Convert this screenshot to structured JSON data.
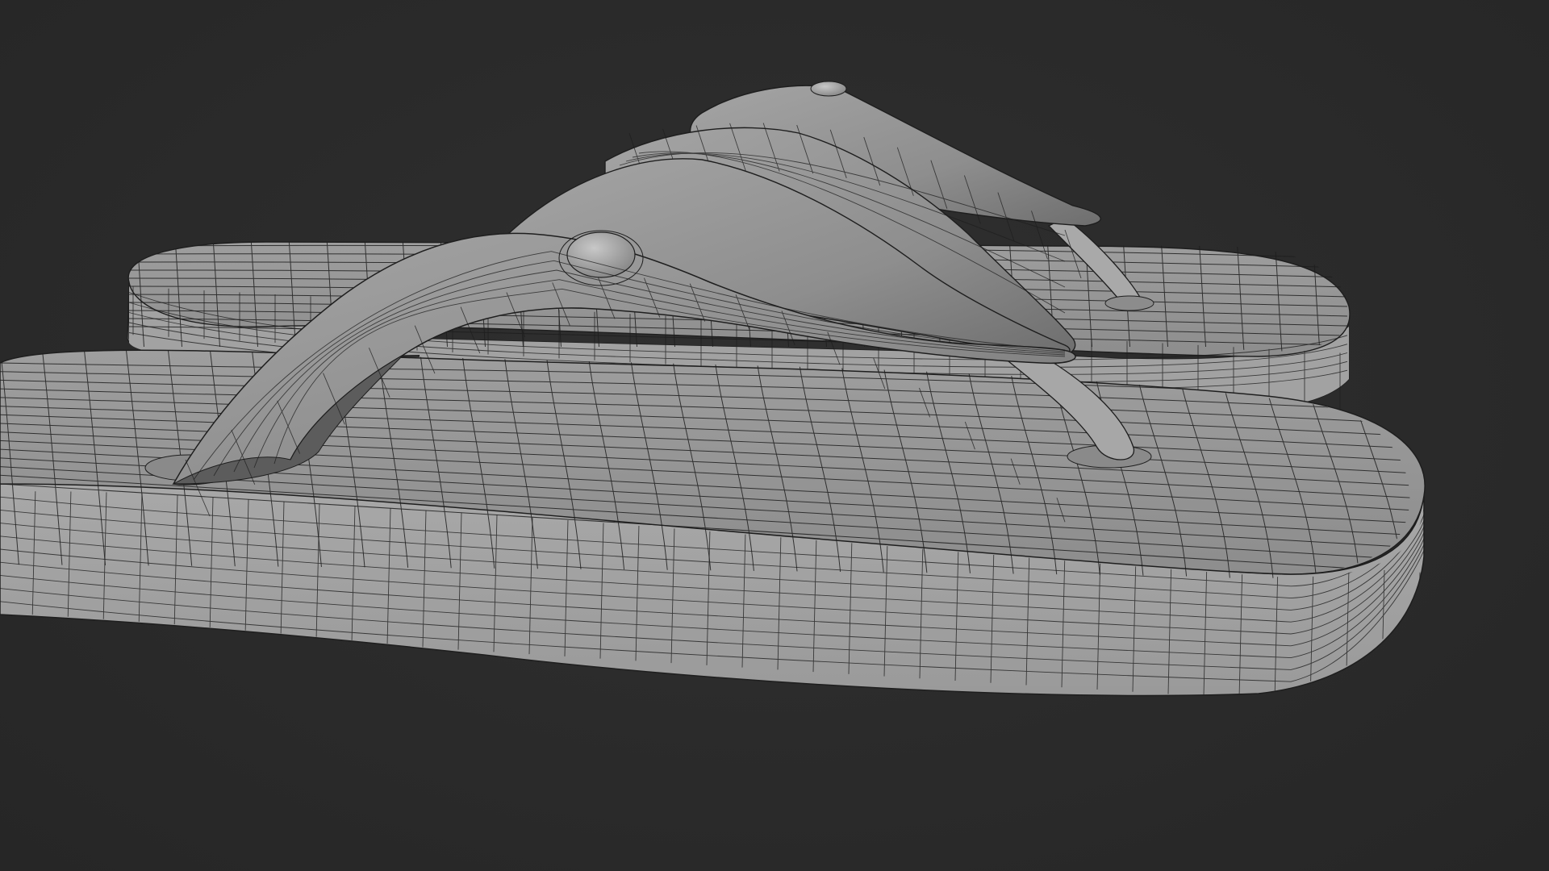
{
  "scene": {
    "subject": "flip-flop-sandals-wireframe",
    "viewport_background": "#2b2b2b",
    "shading_color": "#9a9a9a",
    "wire_color": "#1e1e1e",
    "objects": [
      "back-sandal",
      "front-sandal"
    ],
    "render_mode": "solid-with-wireframe"
  }
}
